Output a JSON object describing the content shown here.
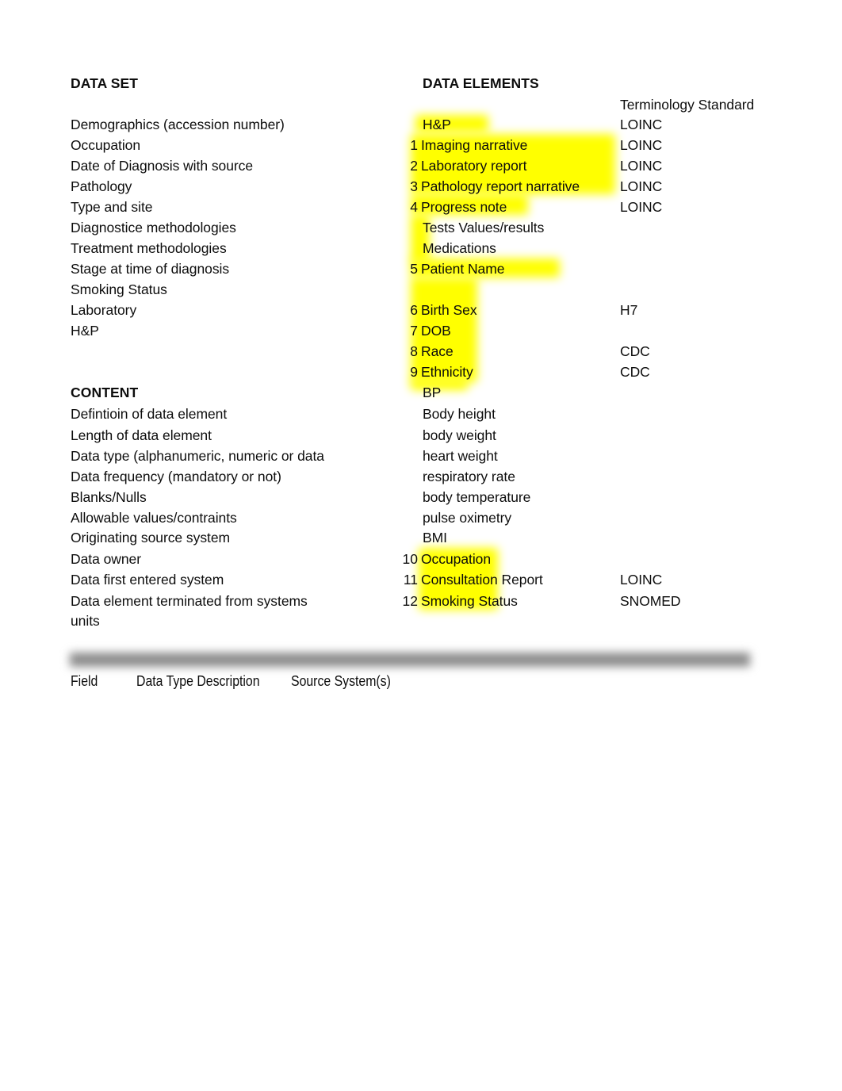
{
  "document": {
    "page_background": "#ffffff",
    "text_color": "#0d0d0d",
    "highlight_color": "#ffff00",
    "separator_color": "#8d8d8d"
  },
  "headers": {
    "data_set": "DATA SET",
    "data_elements": "DATA ELEMENTS",
    "terminology_standard": "Terminology Standard",
    "content": "CONTENT"
  },
  "data_set_items": [
    "Demographics (accession number)",
    "Occupation",
    "Date of Diagnosis with source",
    "Pathology",
    "Type and site",
    "Diagnostice methodologies",
    "Treatment methodologies",
    "Stage at time of diagnosis",
    "Smoking Status",
    "Laboratory",
    "H&P"
  ],
  "content_items": [
    "Defintioin of data element",
    "Length of data element",
    "Data type (alphanumeric, numeric or data",
    "Data frequency (mandatory or not)",
    "Blanks/Nulls",
    "Allowable values/contraints",
    "Originating source system",
    "Data owner",
    "Data first entered system",
    "Data element terminated from systems",
    "units"
  ],
  "data_elements": [
    {
      "number": "",
      "label": "H&P",
      "standard": "LOINC",
      "highlighted": true
    },
    {
      "number": "1",
      "label": "Imaging narrative",
      "standard": "LOINC",
      "highlighted": true
    },
    {
      "number": "2",
      "label": "Laboratory report",
      "standard": "LOINC",
      "highlighted": true
    },
    {
      "number": "3",
      "label": "Pathology report narrative",
      "standard": "LOINC",
      "highlighted": true
    },
    {
      "number": "4",
      "label": "Progress note",
      "standard": "LOINC",
      "highlighted": true
    },
    {
      "number": "",
      "label": "Tests Values/results",
      "standard": "",
      "highlighted": false
    },
    {
      "number": "",
      "label": "Medications",
      "standard": "",
      "highlighted": false
    },
    {
      "number": "5",
      "label": "Patient Name",
      "standard": "",
      "highlighted": true
    },
    {
      "number": "6",
      "label": "Birth Sex",
      "standard": "H7",
      "highlighted": true
    },
    {
      "number": "7",
      "label": "DOB",
      "standard": "",
      "highlighted": true
    },
    {
      "number": "8",
      "label": "Race",
      "standard": "CDC",
      "highlighted": true
    },
    {
      "number": "9",
      "label": "Ethnicity",
      "standard": "CDC",
      "highlighted": true
    },
    {
      "number": "",
      "label": "BP",
      "standard": "",
      "highlighted": false
    },
    {
      "number": "",
      "label": "Body height",
      "standard": "",
      "highlighted": false
    },
    {
      "number": "",
      "label": "body weight",
      "standard": "",
      "highlighted": false
    },
    {
      "number": "",
      "label": "heart weight",
      "standard": "",
      "highlighted": false
    },
    {
      "number": "",
      "label": "respiratory rate",
      "standard": "",
      "highlighted": false
    },
    {
      "number": "",
      "label": "body temperature",
      "standard": "",
      "highlighted": false
    },
    {
      "number": "",
      "label": "pulse oximetry",
      "standard": "",
      "highlighted": false
    },
    {
      "number": "",
      "label": "BMI",
      "standard": "",
      "highlighted": false
    },
    {
      "number": "10",
      "label": "Occupation",
      "standard": "",
      "highlighted": true
    },
    {
      "number": "11",
      "label": "Consultation Report",
      "standard": "LOINC",
      "highlighted": true
    },
    {
      "number": "12",
      "label": "Smoking Status",
      "standard": "SNOMED",
      "highlighted": true
    }
  ],
  "bottom_table_headers": [
    "Field",
    "Data Type Description",
    "Source System(s)"
  ]
}
